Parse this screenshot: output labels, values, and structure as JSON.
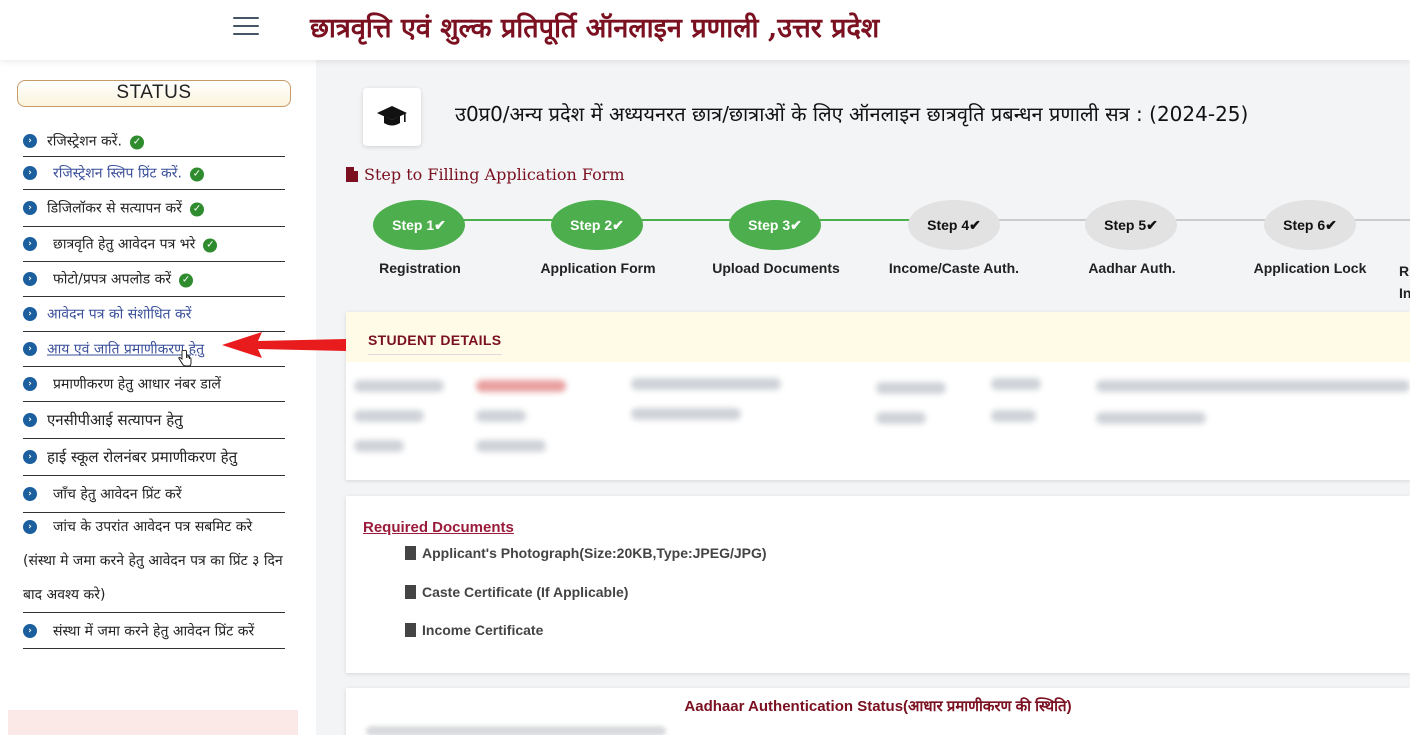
{
  "header": {
    "title": "छात्रवृत्ति एवं शुल्क प्रतिपूर्ति ऑनलाइन प्रणाली ,उत्तर प्रदेश",
    "menu_icon": "hamburger-menu-icon"
  },
  "sidebar": {
    "status_label": "STATUS",
    "items": [
      {
        "label": "रजिस्ट्रेशन करें.",
        "done": true
      },
      {
        "label": "रजिस्ट्रेशन स्लिप प्रिंट करें.",
        "done": true
      },
      {
        "label": "डिजिलॉकर से सत्यापन करें",
        "done": true
      },
      {
        "label": "छात्रवृति हेतु आवेदन पत्र भरे",
        "done": true
      },
      {
        "label": "फोटो/प्रपत्र अपलोड करें",
        "done": true
      },
      {
        "label": "आवेदन पत्र को संशोधित करें",
        "done": false
      },
      {
        "label": "आय एवं जाति प्रमाणीकरण हेतु",
        "done": false
      },
      {
        "label": "प्रमाणीकरण हेतु आधार नंबर डालें",
        "done": false
      },
      {
        "label": "एनसीपीआई सत्यापन हेतु",
        "done": false
      },
      {
        "label": "हाई स्कूल रोलनंबर प्रमाणीकरण हेतु",
        "done": false
      },
      {
        "label": "जाँच हेतु आवेदन प्रिंट करें",
        "done": false
      }
    ],
    "submit_item": {
      "line1": "जांच के उपरांत आवेदन पत्र सबमिट करे",
      "line2": "(संस्था मे जमा करने हेतु आवेदन पत्र का प्रिंट ३ दिन",
      "line3": "बाद अवश्य करे)"
    },
    "last_item": "संस्था में जमा करने हेतु आवेदन प्रिंट करें"
  },
  "main": {
    "heading": "उ0प्र0/अन्य प्रदेश में अध्ययनरत छात्र/छात्राओं के लिए ऑनलाइन छात्रवृति प्रबन्धन प्रणाली सत्र : (2024-25)",
    "steps_title": "Step to Filling Application Form",
    "steps": [
      {
        "label": "Step 1",
        "name": "Registration",
        "status": "done"
      },
      {
        "label": "Step 2",
        "name": "Application Form",
        "status": "done"
      },
      {
        "label": "Step 3",
        "name": "Upload Documents",
        "status": "done"
      },
      {
        "label": "Step 4",
        "name": "Income/Caste Auth.",
        "status": "pending"
      },
      {
        "label": "Step 5",
        "name": "Aadhar Auth.",
        "status": "pending"
      },
      {
        "label": "Step 6",
        "name": "Application Lock",
        "status": "pending"
      }
    ],
    "step7_partial": {
      "line1": "R",
      "line2": "In"
    },
    "student_details_title": "STUDENT DETAILS",
    "required_docs_title": "Required Documents",
    "required_docs": [
      "Applicant's Photograph(Size:20KB,Type:JPEG/JPG)",
      "Caste Certificate (If Applicable)",
      "Income Certificate"
    ],
    "aadhaar_title": "Aadhaar Authentication Status(आधार प्रमाणीकरण की स्थिति)"
  },
  "colors": {
    "brand_maroon": "#7a1020",
    "step_done": "#4cae4c",
    "step_pending": "#e2e2e2",
    "bullet_blue": "#1b5f9e",
    "check_green": "#2e8b2e",
    "annotation_arrow": "#e81c1c"
  }
}
